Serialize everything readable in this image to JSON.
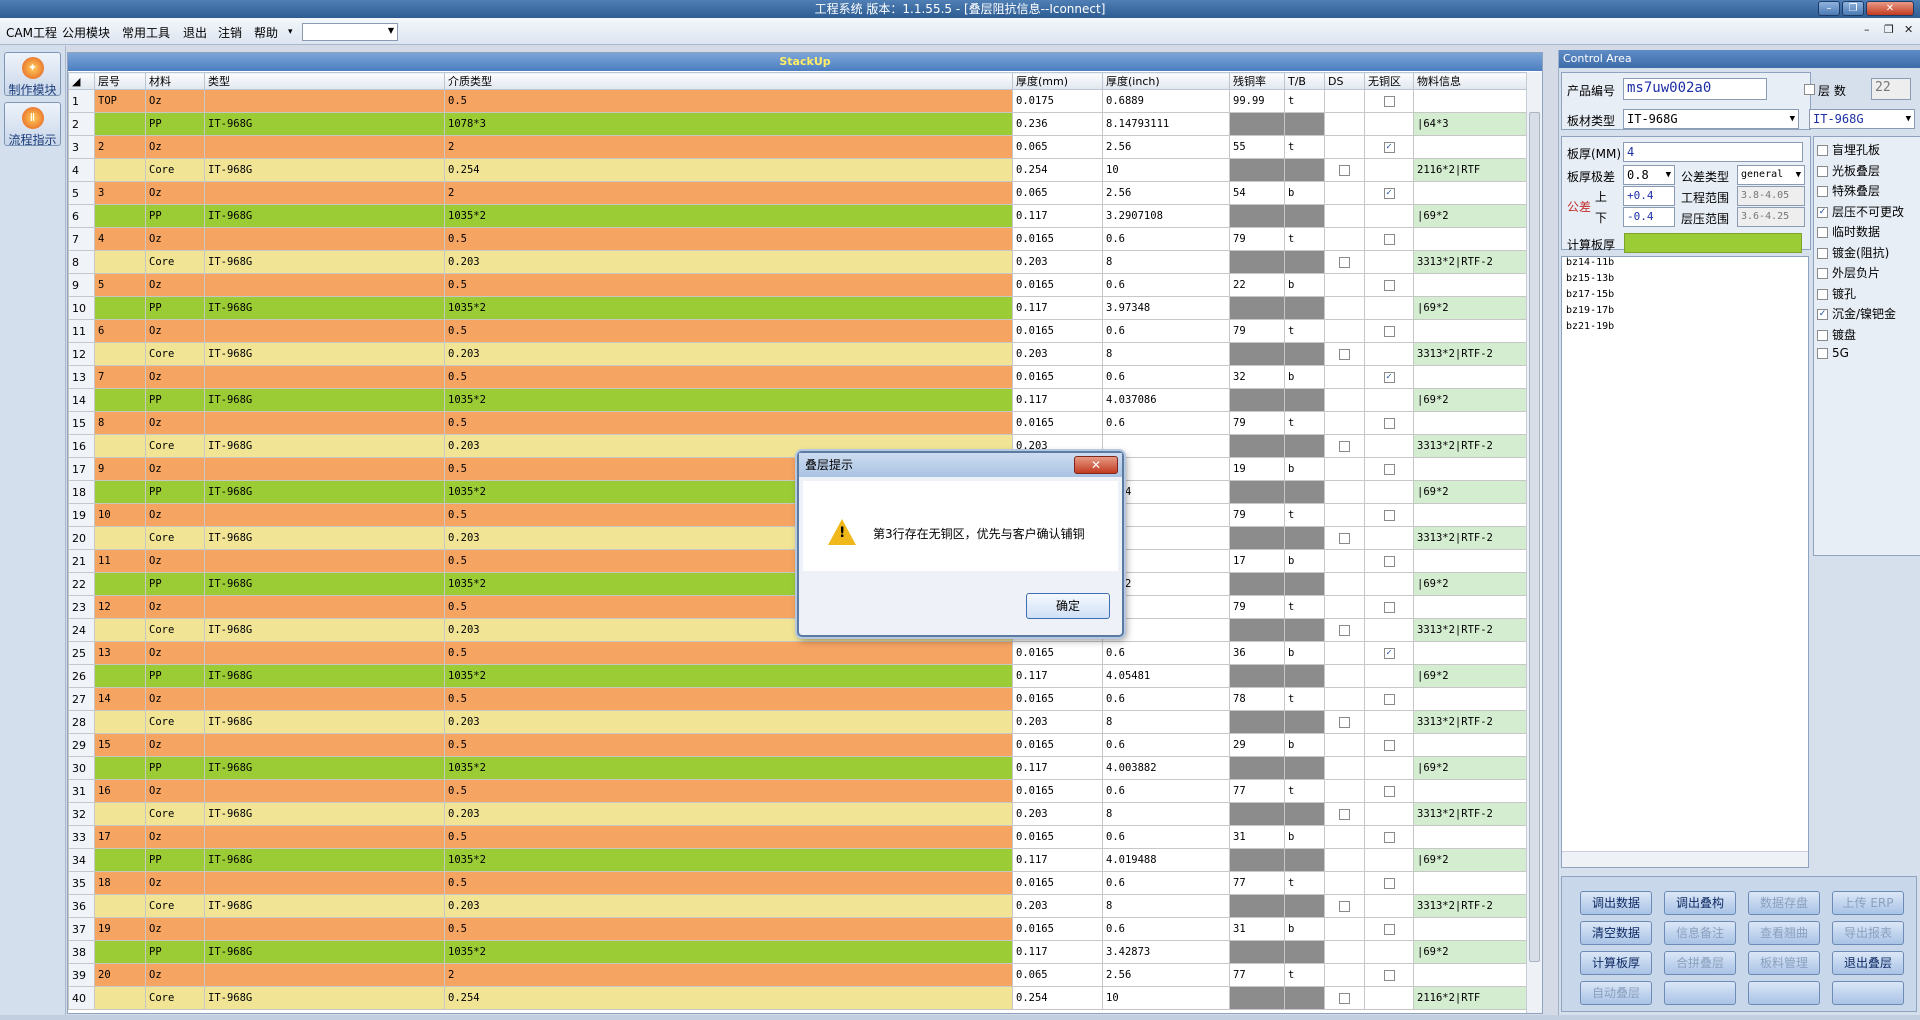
{
  "window": {
    "title": "工程系统  版本：1.1.55.5 - [叠层阻抗信息--Iconnect]"
  },
  "menu": {
    "items": [
      "CAM工程",
      "公用模块",
      "常用工具",
      "退出",
      "注销",
      "帮助"
    ],
    "help_arrow": "▾"
  },
  "left_tools": [
    {
      "label": "制作模块"
    },
    {
      "label": "流程指示"
    }
  ],
  "stackup": {
    "header": "StackUp",
    "columns": [
      "层号",
      "材料",
      "类型",
      "介质类型",
      "厚度(mm)",
      "厚度(inch)",
      "残铜率",
      "T/B",
      "DS",
      "无铜区",
      "物料信息"
    ],
    "rows": [
      {
        "n": "1",
        "layer": "TOP",
        "mat": "Oz",
        "type": "",
        "diel": "0.5",
        "mm": "0.0175",
        "inch": "0.6889",
        "cu": "99.99",
        "tb": "t",
        "ds": "",
        "nocu": "box",
        "info": "",
        "kind": "oz"
      },
      {
        "n": "2",
        "layer": "",
        "mat": "PP",
        "type": "IT-968G",
        "diel": "1078*3",
        "mm": "0.236",
        "inch": "8.14793111",
        "cu": "",
        "tb": "",
        "ds": "",
        "nocu": "",
        "info": "|64*3",
        "kind": "pp"
      },
      {
        "n": "3",
        "layer": "2",
        "mat": "Oz",
        "type": "",
        "diel": "2",
        "mm": "0.065",
        "inch": "2.56",
        "cu": "55",
        "tb": "t",
        "ds": "",
        "nocu": "checked",
        "info": "",
        "kind": "oz"
      },
      {
        "n": "4",
        "layer": "",
        "mat": "Core",
        "type": "IT-968G",
        "diel": "0.254",
        "mm": "0.254",
        "inch": "10",
        "cu": "",
        "tb": "",
        "ds": "box",
        "nocu": "",
        "info": "2116*2|RTF",
        "kind": "core"
      },
      {
        "n": "5",
        "layer": "3",
        "mat": "Oz",
        "type": "",
        "diel": "2",
        "mm": "0.065",
        "inch": "2.56",
        "cu": "54",
        "tb": "b",
        "ds": "",
        "nocu": "checked",
        "info": "",
        "kind": "oz"
      },
      {
        "n": "6",
        "layer": "",
        "mat": "PP",
        "type": "IT-968G",
        "diel": "1035*2",
        "mm": "0.117",
        "inch": "3.2907108",
        "cu": "",
        "tb": "",
        "ds": "",
        "nocu": "",
        "info": "|69*2",
        "kind": "pp"
      },
      {
        "n": "7",
        "layer": "4",
        "mat": "Oz",
        "type": "",
        "diel": "0.5",
        "mm": "0.0165",
        "inch": "0.6",
        "cu": "79",
        "tb": "t",
        "ds": "",
        "nocu": "box",
        "info": "",
        "kind": "oz"
      },
      {
        "n": "8",
        "layer": "",
        "mat": "Core",
        "type": "IT-968G",
        "diel": "0.203",
        "mm": "0.203",
        "inch": "8",
        "cu": "",
        "tb": "",
        "ds": "box",
        "nocu": "",
        "info": "3313*2|RTF-2",
        "kind": "core"
      },
      {
        "n": "9",
        "layer": "5",
        "mat": "Oz",
        "type": "",
        "diel": "0.5",
        "mm": "0.0165",
        "inch": "0.6",
        "cu": "22",
        "tb": "b",
        "ds": "",
        "nocu": "box",
        "info": "",
        "kind": "oz"
      },
      {
        "n": "10",
        "layer": "",
        "mat": "PP",
        "type": "IT-968G",
        "diel": "1035*2",
        "mm": "0.117",
        "inch": "3.97348",
        "cu": "",
        "tb": "",
        "ds": "",
        "nocu": "",
        "info": "|69*2",
        "kind": "pp"
      },
      {
        "n": "11",
        "layer": "6",
        "mat": "Oz",
        "type": "",
        "diel": "0.5",
        "mm": "0.0165",
        "inch": "0.6",
        "cu": "79",
        "tb": "t",
        "ds": "",
        "nocu": "box",
        "info": "",
        "kind": "oz"
      },
      {
        "n": "12",
        "layer": "",
        "mat": "Core",
        "type": "IT-968G",
        "diel": "0.203",
        "mm": "0.203",
        "inch": "8",
        "cu": "",
        "tb": "",
        "ds": "box",
        "nocu": "",
        "info": "3313*2|RTF-2",
        "kind": "core"
      },
      {
        "n": "13",
        "layer": "7",
        "mat": "Oz",
        "type": "",
        "diel": "0.5",
        "mm": "0.0165",
        "inch": "0.6",
        "cu": "32",
        "tb": "b",
        "ds": "",
        "nocu": "checked",
        "info": "",
        "kind": "oz"
      },
      {
        "n": "14",
        "layer": "",
        "mat": "PP",
        "type": "IT-968G",
        "diel": "1035*2",
        "mm": "0.117",
        "inch": "4.037086",
        "cu": "",
        "tb": "",
        "ds": "",
        "nocu": "",
        "info": "|69*2",
        "kind": "pp"
      },
      {
        "n": "15",
        "layer": "8",
        "mat": "Oz",
        "type": "",
        "diel": "0.5",
        "mm": "0.0165",
        "inch": "0.6",
        "cu": "79",
        "tb": "t",
        "ds": "",
        "nocu": "box",
        "info": "",
        "kind": "oz"
      },
      {
        "n": "16",
        "layer": "",
        "mat": "Core",
        "type": "IT-968G",
        "diel": "0.203",
        "mm": "0.203",
        "inch": "",
        "cu": "",
        "tb": "",
        "ds": "box",
        "nocu": "",
        "info": "3313*2|RTF-2",
        "kind": "core"
      },
      {
        "n": "17",
        "layer": "9",
        "mat": "Oz",
        "type": "",
        "diel": "0.5",
        "mm": "",
        "inch": "",
        "cu": "19",
        "tb": "b",
        "ds": "",
        "nocu": "box",
        "info": "",
        "kind": "oz"
      },
      {
        "n": "18",
        "layer": "",
        "mat": "PP",
        "type": "IT-968G",
        "diel": "1035*2",
        "mm": "",
        "inch": "8534",
        "cu": "",
        "tb": "",
        "ds": "",
        "nocu": "",
        "info": "|69*2",
        "kind": "pp"
      },
      {
        "n": "19",
        "layer": "10",
        "mat": "Oz",
        "type": "",
        "diel": "0.5",
        "mm": "",
        "inch": "",
        "cu": "79",
        "tb": "t",
        "ds": "",
        "nocu": "box",
        "info": "",
        "kind": "oz"
      },
      {
        "n": "20",
        "layer": "",
        "mat": "Core",
        "type": "IT-968G",
        "diel": "0.203",
        "mm": "",
        "inch": "",
        "cu": "",
        "tb": "",
        "ds": "box",
        "nocu": "",
        "info": "3313*2|RTF-2",
        "kind": "core"
      },
      {
        "n": "21",
        "layer": "11",
        "mat": "Oz",
        "type": "",
        "diel": "0.5",
        "mm": "",
        "inch": "",
        "cu": "17",
        "tb": "b",
        "ds": "",
        "nocu": "box",
        "info": "",
        "kind": "oz"
      },
      {
        "n": "22",
        "layer": "",
        "mat": "PP",
        "type": "IT-968G",
        "diel": "1035*2",
        "mm": "",
        "inch": "7662",
        "cu": "",
        "tb": "",
        "ds": "",
        "nocu": "",
        "info": "|69*2",
        "kind": "pp"
      },
      {
        "n": "23",
        "layer": "12",
        "mat": "Oz",
        "type": "",
        "diel": "0.5",
        "mm": "",
        "inch": "",
        "cu": "79",
        "tb": "t",
        "ds": "",
        "nocu": "box",
        "info": "",
        "kind": "oz"
      },
      {
        "n": "24",
        "layer": "",
        "mat": "Core",
        "type": "IT-968G",
        "diel": "0.203",
        "mm": "",
        "inch": "8",
        "cu": "",
        "tb": "",
        "ds": "box",
        "nocu": "",
        "info": "3313*2|RTF-2",
        "kind": "core"
      },
      {
        "n": "25",
        "layer": "13",
        "mat": "Oz",
        "type": "",
        "diel": "0.5",
        "mm": "0.0165",
        "inch": "0.6",
        "cu": "36",
        "tb": "b",
        "ds": "",
        "nocu": "checked",
        "info": "",
        "kind": "oz"
      },
      {
        "n": "26",
        "layer": "",
        "mat": "PP",
        "type": "IT-968G",
        "diel": "1035*2",
        "mm": "0.117",
        "inch": "4.05481",
        "cu": "",
        "tb": "",
        "ds": "",
        "nocu": "",
        "info": "|69*2",
        "kind": "pp"
      },
      {
        "n": "27",
        "layer": "14",
        "mat": "Oz",
        "type": "",
        "diel": "0.5",
        "mm": "0.0165",
        "inch": "0.6",
        "cu": "78",
        "tb": "t",
        "ds": "",
        "nocu": "box",
        "info": "",
        "kind": "oz"
      },
      {
        "n": "28",
        "layer": "",
        "mat": "Core",
        "type": "IT-968G",
        "diel": "0.203",
        "mm": "0.203",
        "inch": "8",
        "cu": "",
        "tb": "",
        "ds": "box",
        "nocu": "",
        "info": "3313*2|RTF-2",
        "kind": "core"
      },
      {
        "n": "29",
        "layer": "15",
        "mat": "Oz",
        "type": "",
        "diel": "0.5",
        "mm": "0.0165",
        "inch": "0.6",
        "cu": "29",
        "tb": "b",
        "ds": "",
        "nocu": "box",
        "info": "",
        "kind": "oz"
      },
      {
        "n": "30",
        "layer": "",
        "mat": "PP",
        "type": "IT-968G",
        "diel": "1035*2",
        "mm": "0.117",
        "inch": "4.003882",
        "cu": "",
        "tb": "",
        "ds": "",
        "nocu": "",
        "info": "|69*2",
        "kind": "pp"
      },
      {
        "n": "31",
        "layer": "16",
        "mat": "Oz",
        "type": "",
        "diel": "0.5",
        "mm": "0.0165",
        "inch": "0.6",
        "cu": "77",
        "tb": "t",
        "ds": "",
        "nocu": "box",
        "info": "",
        "kind": "oz"
      },
      {
        "n": "32",
        "layer": "",
        "mat": "Core",
        "type": "IT-968G",
        "diel": "0.203",
        "mm": "0.203",
        "inch": "8",
        "cu": "",
        "tb": "",
        "ds": "box",
        "nocu": "",
        "info": "3313*2|RTF-2",
        "kind": "core"
      },
      {
        "n": "33",
        "layer": "17",
        "mat": "Oz",
        "type": "",
        "diel": "0.5",
        "mm": "0.0165",
        "inch": "0.6",
        "cu": "31",
        "tb": "b",
        "ds": "",
        "nocu": "box",
        "info": "",
        "kind": "oz"
      },
      {
        "n": "34",
        "layer": "",
        "mat": "PP",
        "type": "IT-968G",
        "diel": "1035*2",
        "mm": "0.117",
        "inch": "4.019488",
        "cu": "",
        "tb": "",
        "ds": "",
        "nocu": "",
        "info": "|69*2",
        "kind": "pp"
      },
      {
        "n": "35",
        "layer": "18",
        "mat": "Oz",
        "type": "",
        "diel": "0.5",
        "mm": "0.0165",
        "inch": "0.6",
        "cu": "77",
        "tb": "t",
        "ds": "",
        "nocu": "box",
        "info": "",
        "kind": "oz"
      },
      {
        "n": "36",
        "layer": "",
        "mat": "Core",
        "type": "IT-968G",
        "diel": "0.203",
        "mm": "0.203",
        "inch": "8",
        "cu": "",
        "tb": "",
        "ds": "box",
        "nocu": "",
        "info": "3313*2|RTF-2",
        "kind": "core"
      },
      {
        "n": "37",
        "layer": "19",
        "mat": "Oz",
        "type": "",
        "diel": "0.5",
        "mm": "0.0165",
        "inch": "0.6",
        "cu": "31",
        "tb": "b",
        "ds": "",
        "nocu": "box",
        "info": "",
        "kind": "oz"
      },
      {
        "n": "38",
        "layer": "",
        "mat": "PP",
        "type": "IT-968G",
        "diel": "1035*2",
        "mm": "0.117",
        "inch": "3.42873",
        "cu": "",
        "tb": "",
        "ds": "",
        "nocu": "",
        "info": "|69*2",
        "kind": "pp"
      },
      {
        "n": "39",
        "layer": "20",
        "mat": "Oz",
        "type": "",
        "diel": "2",
        "mm": "0.065",
        "inch": "2.56",
        "cu": "77",
        "tb": "t",
        "ds": "",
        "nocu": "box",
        "info": "",
        "kind": "oz"
      },
      {
        "n": "40",
        "layer": "",
        "mat": "Core",
        "type": "IT-968G",
        "diel": "0.254",
        "mm": "0.254",
        "inch": "10",
        "cu": "",
        "tb": "",
        "ds": "box",
        "nocu": "",
        "info": "2116*2|RTF",
        "kind": "core"
      }
    ]
  },
  "control": {
    "header": "Control Area",
    "product_label": "产品编号",
    "product_value": "ms7uw002a0",
    "layers_label": "层 数",
    "layers_value": "22",
    "board_type_label": "板材类型",
    "board_type_value": "IT-968G",
    "board_type_value2": "IT-968G",
    "thickness_label": "板厚(MM)",
    "thickness_value": "4",
    "tol_label": "板厚极差",
    "tol_value": "0.8",
    "tol_type_label": "公差类型",
    "tol_type_value": "general",
    "tolerance_label": "公差",
    "upper_label": "上",
    "upper_value": "+0.4",
    "lower_label": "下",
    "lower_value": "-0.4",
    "eng_range_label": "工程范围",
    "eng_range_value": "3.8-4.05",
    "press_range_label": "层压范围",
    "press_range_value": "3.6-4.25",
    "calc_label": "计算板厚",
    "checks": [
      {
        "label": "盲埋孔板",
        "checked": false
      },
      {
        "label": "光板叠层",
        "checked": false
      },
      {
        "label": "特殊叠层",
        "checked": false
      },
      {
        "label": "层压不可更改",
        "checked": true
      },
      {
        "label": "临时数据",
        "checked": false
      },
      {
        "label": "镀金(阻抗)",
        "checked": false
      },
      {
        "label": "外层负片",
        "checked": false
      },
      {
        "label": "镀孔",
        "checked": false
      },
      {
        "label": "沉金/镍钯金",
        "checked": true
      },
      {
        "label": "镀盘",
        "checked": false
      },
      {
        "label": "5G",
        "checked": false
      }
    ],
    "holes": [
      "bz14-11b",
      "bz15-13b",
      "bz17-15b",
      "bz19-17b",
      "bz21-19b"
    ],
    "buttons": [
      {
        "label": "调出数据",
        "disabled": false
      },
      {
        "label": "调出叠构",
        "disabled": false
      },
      {
        "label": "数据存盘",
        "disabled": true
      },
      {
        "label": "上传 ERP",
        "disabled": true
      },
      {
        "label": "清空数据",
        "disabled": false
      },
      {
        "label": "信息备注",
        "disabled": true
      },
      {
        "label": "查看翘曲",
        "disabled": true
      },
      {
        "label": "导出报表",
        "disabled": true
      },
      {
        "label": "计算板厚",
        "disabled": false
      },
      {
        "label": "合拼叠层",
        "disabled": true
      },
      {
        "label": "板料管理",
        "disabled": true
      },
      {
        "label": "退出叠层",
        "disabled": false
      },
      {
        "label": "自动叠层",
        "disabled": true
      },
      {
        "label": "",
        "disabled": false
      },
      {
        "label": "",
        "disabled": false
      },
      {
        "label": "",
        "disabled": false
      }
    ]
  },
  "dialog": {
    "title": "叠层提示",
    "message": "第3行存在无铜区，优先与客户确认铺铜",
    "ok_label": "确定",
    "close_glyph": "✕"
  },
  "colors": {
    "oz": "#f5a462",
    "pp": "#9ccc35",
    "core": "#f1e595",
    "light_green": "#d4ecd0",
    "gray_cell": "#8c8c8c"
  }
}
